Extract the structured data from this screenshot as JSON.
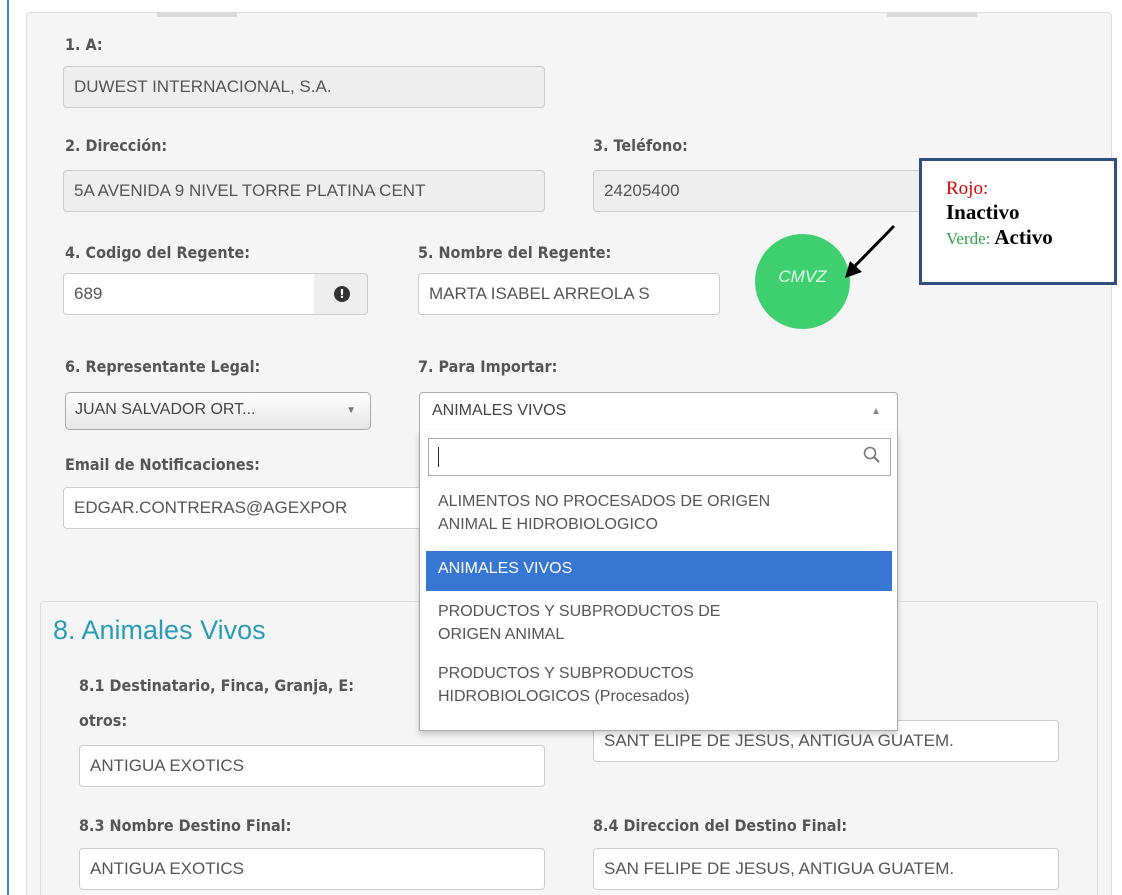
{
  "form": {
    "field1": {
      "label": "1. A:",
      "value": "DUWEST INTERNACIONAL, S.A."
    },
    "field2": {
      "label": "2. Dirección:",
      "value": "5A AVENIDA 9 NIVEL TORRE PLATINA CENT"
    },
    "field3": {
      "label": "3. Teléfono:",
      "value": "24205400"
    },
    "field4": {
      "label": "4. Codigo del Regente:",
      "value": "689"
    },
    "field5": {
      "label": "5. Nombre del Regente:",
      "value": "MARTA ISABEL ARREOLA S"
    },
    "status_badge": {
      "text": "CMVZ",
      "color": "#3ecf6e"
    },
    "field6": {
      "label": "6. Representante Legal:",
      "value": "JUAN SALVADOR ORT..."
    },
    "field7": {
      "label": "7. Para Importar:",
      "value": "ANIMALES VIVOS",
      "search_value": "",
      "options": [
        {
          "line1": "ALIMENTOS NO PROCESADOS DE ORIGEN",
          "line2": "ANIMAL E HIDROBIOLOGICO"
        },
        {
          "line1": "ANIMALES VIVOS",
          "line2": ""
        },
        {
          "line1": "PRODUCTOS Y SUBPRODUCTOS DE",
          "line2": "ORIGEN ANIMAL"
        },
        {
          "line1": "PRODUCTOS Y SUBPRODUCTOS",
          "line2": "HIDROBIOLOGICOS (Procesados)"
        }
      ],
      "selected_index": 1
    },
    "email": {
      "label": "Email de Notificaciones:",
      "value": "EDGAR.CONTRERAS@AGEXPOR"
    }
  },
  "section8": {
    "title": "8. Animales Vivos",
    "f81": {
      "label_line1": "8.1 Destinatario, Finca, Granja, E:",
      "label_line2": "otros:",
      "value": "ANTIGUA EXOTICS"
    },
    "f82": {
      "value": "SANT ELIPE DE JESUS, ANTIGUA GUATEM."
    },
    "f83": {
      "label": "8.3 Nombre Destino Final:",
      "value": "ANTIGUA EXOTICS"
    },
    "f84": {
      "label": "8.4 Direccion del Destino Final:",
      "value": "SAN FELIPE DE JESUS, ANTIGUA GUATEM."
    }
  },
  "legend": {
    "red_label": "Rojo:",
    "red_state": "Inactivo",
    "green_label": "Verde:",
    "green_state": "Activo"
  },
  "colors": {
    "accent": "#3876d4",
    "section_title": "#2a9bb8",
    "legend_red": "#e00000",
    "legend_green": "#2fa34a"
  }
}
